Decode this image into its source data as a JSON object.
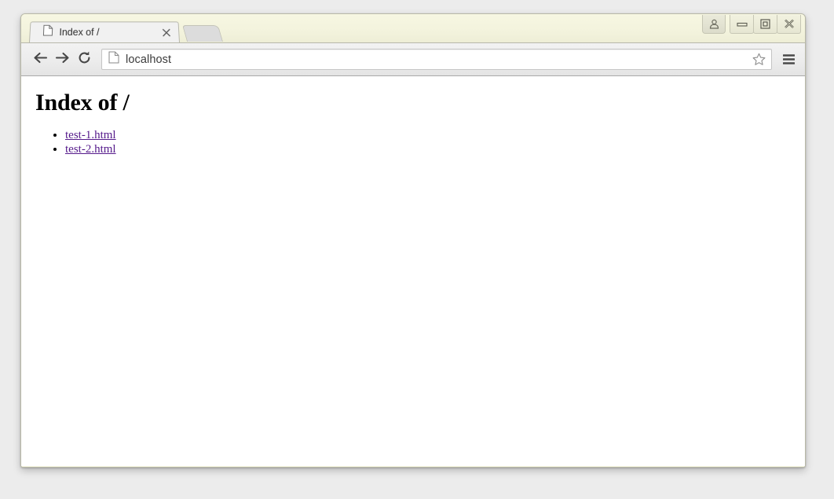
{
  "window": {
    "frame_color": "#fbfbe6",
    "controls": [
      {
        "name": "profile-avatar-button",
        "icon": "user-avatar-icon",
        "label": ""
      },
      {
        "name": "minimize-button",
        "icon": "minimize-icon",
        "label": ""
      },
      {
        "name": "maximize-button",
        "icon": "maximize-icon",
        "label": ""
      },
      {
        "name": "close-button",
        "icon": "close-icon",
        "label": ""
      }
    ]
  },
  "tabstrip": {
    "tabs": [
      {
        "title": "Index of /",
        "favicon": "page-icon",
        "close_icon": "close-icon",
        "active": true
      }
    ],
    "new_tab_label": ""
  },
  "toolbar": {
    "back_icon": "arrow-left-icon",
    "forward_icon": "arrow-right-icon",
    "reload_icon": "reload-icon",
    "omnibox": {
      "favicon": "page-icon",
      "value": "localhost",
      "placeholder": "Search Google or type URL",
      "star_icon": "star-icon"
    },
    "menu_icon": "hamburger-menu-icon"
  },
  "page": {
    "title": "Index of /",
    "link_color": "#551a8b",
    "files": [
      {
        "label": "test-1.html"
      },
      {
        "label": "test-2.html"
      }
    ]
  }
}
